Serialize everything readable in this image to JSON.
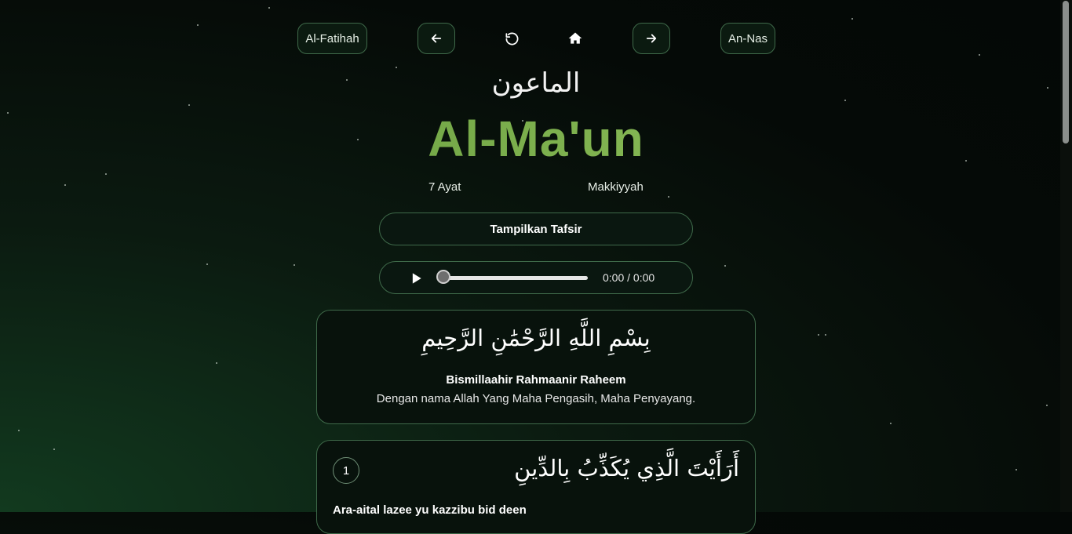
{
  "nav": {
    "prev_surah_label": "Al-Fatihah",
    "next_surah_label": "An-Nas",
    "back_icon": "arrow-left-icon",
    "reload_icon": "rotate-ccw-icon",
    "home_icon": "home-icon",
    "next_icon": "arrow-right-icon"
  },
  "surah": {
    "arabic_name": "الماعون",
    "latin_name": "Al-Ma'un",
    "ayat_count": "7 Ayat",
    "revelation": "Makkiyyah"
  },
  "tafsir_button_label": "Tampilkan Tafsir",
  "audio": {
    "time": "0:00 / 0:00",
    "progress": 0,
    "play_icon": "play-icon"
  },
  "bismillah": {
    "arabic": "بِسْمِ اللَّهِ الرَّحْمَٰنِ الرَّحِيمِ",
    "latin": "Bismillaahir Rahmaanir Raheem",
    "translation": "Dengan nama Allah Yang Maha Pengasih, Maha Penyayang."
  },
  "ayahs": [
    {
      "number": "1",
      "arabic": "أَرَأَيْتَ الَّذِي يُكَذِّبُ بِالدِّينِ",
      "latin": "Ara-aital lazee yu kazzibu bid deen"
    }
  ],
  "colors": {
    "accent": "#7fb24f",
    "border": "#3f6a4a",
    "background": "#050a07"
  }
}
